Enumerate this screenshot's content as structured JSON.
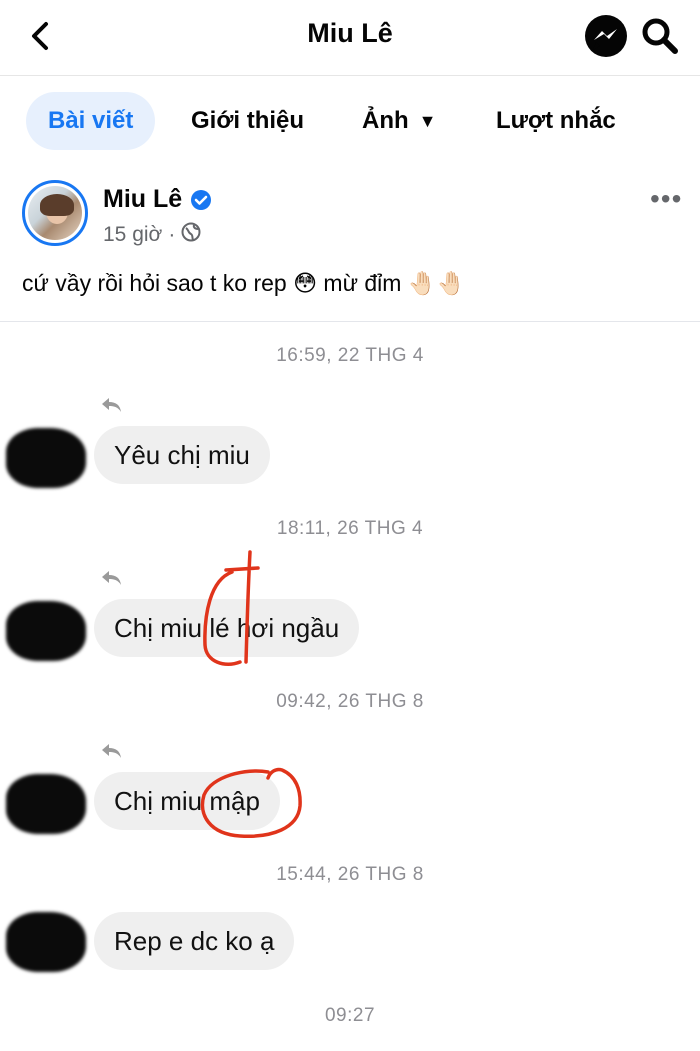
{
  "header": {
    "title": "Miu Lê"
  },
  "tabs": [
    {
      "label": "Bài viết",
      "active": true
    },
    {
      "label": "Giới thiệu"
    },
    {
      "label": "Ảnh",
      "caret": "▼"
    },
    {
      "label": "Lượt nhắc"
    }
  ],
  "post": {
    "author": "Miu Lê",
    "time": "15 giờ",
    "separator": "·",
    "caption": "cứ vầy rồi hỏi sao t ko rep 😳  mừ đỉm 🤚🏻🤚🏻",
    "more": "•••"
  },
  "chat": {
    "timestamps": [
      "16:59, 22 THG 4",
      "18:11, 26 THG 4",
      "09:42, 26 THG 8",
      "15:44, 26 THG 8",
      "09:27"
    ],
    "messages": [
      "Yêu chị miu",
      "Chị miu lé hơi ngầu",
      "Chị miu mập",
      "Rep e dc ko ạ"
    ]
  },
  "colors": {
    "accent": "#1877f2",
    "tab_active_bg": "#e7f0fd",
    "bubble_bg": "#efefef",
    "annotation": "#e0341b"
  },
  "icons": [
    "back-chevron-icon",
    "messenger-icon",
    "search-icon",
    "verified-badge-icon",
    "globe-icon",
    "more-dots-icon",
    "reply-arrow-icon"
  ]
}
